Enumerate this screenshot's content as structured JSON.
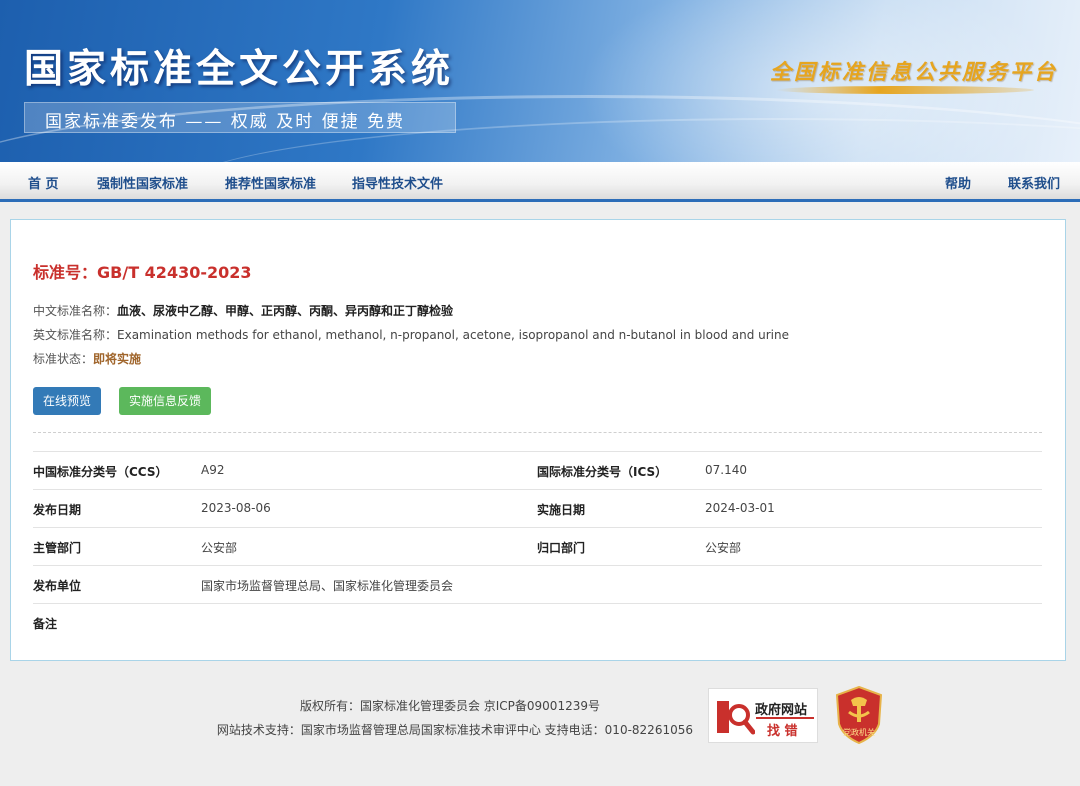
{
  "header": {
    "site_title": "国家标准全文公开系统",
    "slogan": "国家标准委发布 —— 权威 及时 便捷 免费",
    "platform_name": "全国标准信息公共服务平台"
  },
  "nav": {
    "items": [
      "首 页",
      "强制性国家标准",
      "推荐性国家标准",
      "指导性技术文件"
    ],
    "help": "帮助",
    "contact": "联系我们"
  },
  "standard": {
    "number_label": "标准号：",
    "number": "GB/T 42430-2023",
    "cn_name_label": "中文标准名称：",
    "cn_name": "血液、尿液中乙醇、甲醇、正丙醇、丙酮、异丙醇和正丁醇检验",
    "en_name_label": "英文标准名称：",
    "en_name": "Examination methods for ethanol, methanol, n-propanol, acetone, isopropanol and n-butanol in blood and urine",
    "status_label": "标准状态：",
    "status": "即将实施"
  },
  "buttons": {
    "preview": "在线预览",
    "feedback": "实施信息反馈"
  },
  "details": {
    "ccs_label": "中国标准分类号（CCS）",
    "ccs": "A92",
    "ics_label": "国际标准分类号（ICS）",
    "ics": "07.140",
    "publish_date_label": "发布日期",
    "publish_date": "2023-08-06",
    "impl_date_label": "实施日期",
    "impl_date": "2024-03-01",
    "dept_label": "主管部门",
    "dept": "公安部",
    "owner_label": "归口部门",
    "owner": "公安部",
    "issuer_label": "发布单位",
    "issuer": "国家市场监督管理总局、国家标准化管理委员会",
    "remark_label": "备注"
  },
  "footer": {
    "copyright": "版权所有：国家标准化管理委员会 京ICP备09001239号",
    "support": "网站技术支持：国家市场监督管理总局国家标准技术审评中心 支持电话：010-82261056",
    "gov_badge_line1": "政府网站",
    "gov_badge_line2": "找 错",
    "party_badge": "党政机关"
  },
  "colors": {
    "brand_blue": "#2c6db8",
    "accent_red": "#c9302c",
    "status_brown": "#a0652b",
    "btn_blue": "#337ab7",
    "btn_green": "#5cb85c"
  }
}
